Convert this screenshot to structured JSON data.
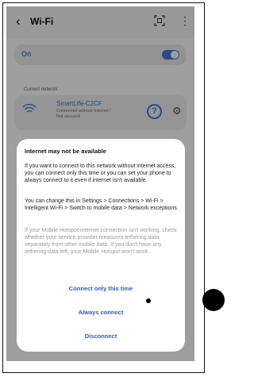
{
  "header": {
    "title": "Wi-Fi",
    "back_icon": "chevron-left-icon",
    "qr_icon": "qr-scan-icon",
    "more_icon": "more-vertical-icon"
  },
  "toggle_row": {
    "label": "On",
    "enabled": true
  },
  "current_network": {
    "section_label": "Current network",
    "name": "SmartLife-C2CF",
    "status_line1": "Connected without Internet /",
    "status_line2": "Not secured"
  },
  "dialog": {
    "title": "Internet may not be available",
    "paragraph1": "If you want to connect to this network without internet access, you can connect only this time or you can set your phone to always connect to it even if internet isn't available.",
    "paragraph2": "You can change this in Settings > Connections > Wi-Fi > Intelligent Wi-Fi > Switch to mobile data > Network exceptions.",
    "paragraph3": "If your Mobile Hotspot internet connection isn't working, check whether your service provider measures tethering data separately from other mobile data. If you don't have any tethering data left, your Mobile Hotspot won't work.",
    "actions": {
      "connect_once": "Connect only this time",
      "always_connect": "Always connect",
      "disconnect": "Disconnect"
    }
  },
  "colors": {
    "accent": "#3d79e0",
    "link": "#2c5fc5",
    "scrim": "rgba(0,0,0,0.38)"
  }
}
